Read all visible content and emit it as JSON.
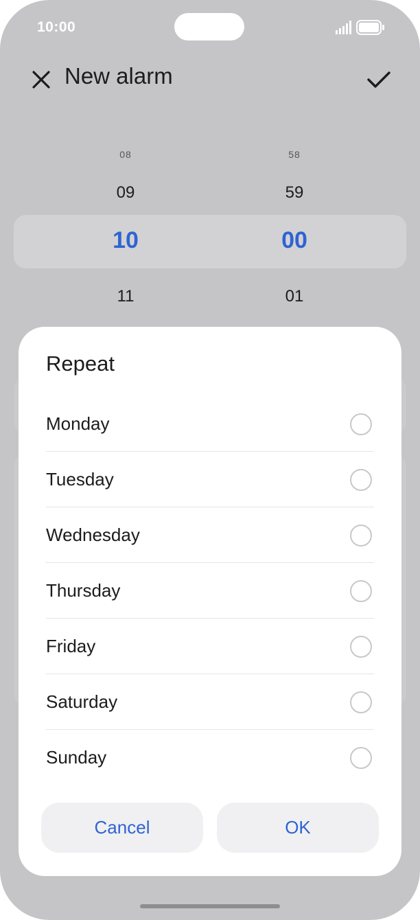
{
  "status_bar": {
    "time": "10:00"
  },
  "header": {
    "title": "New alarm"
  },
  "time_picker": {
    "hours": {
      "far_above": "08",
      "above": "09",
      "selected": "10",
      "below": "11"
    },
    "minutes": {
      "far_above": "58",
      "above": "59",
      "selected": "00",
      "below": "01"
    },
    "accent_color": "#2f63d2"
  },
  "repeat_dialog": {
    "title": "Repeat",
    "days": [
      {
        "label": "Monday",
        "checked": false
      },
      {
        "label": "Tuesday",
        "checked": false
      },
      {
        "label": "Wednesday",
        "checked": false
      },
      {
        "label": "Thursday",
        "checked": false
      },
      {
        "label": "Friday",
        "checked": false
      },
      {
        "label": "Saturday",
        "checked": false
      },
      {
        "label": "Sunday",
        "checked": false
      }
    ],
    "cancel_label": "Cancel",
    "ok_label": "OK"
  }
}
